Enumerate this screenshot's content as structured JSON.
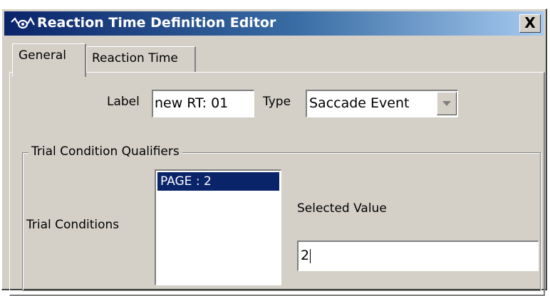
{
  "window": {
    "title": "Reaction Time Definition Editor",
    "close_label": "X",
    "icon": "eye-trajectory-icon"
  },
  "tabs": [
    {
      "label": "General",
      "active": true
    },
    {
      "label": "Reaction Time",
      "active": false
    }
  ],
  "general": {
    "label_caption": "Label",
    "label_value": "new RT: 01",
    "type_caption": "Type",
    "type_value": "Saccade Event",
    "qualifiers_group": "Trial Condition Qualifiers",
    "trial_conditions_caption": "Trial Conditions",
    "trial_conditions": [
      {
        "text": "PAGE : 2",
        "selected": true
      }
    ],
    "selected_value_caption": "Selected Value",
    "selected_value": "2"
  },
  "colors": {
    "title_bar": "#0a246a",
    "dialog_face": "#d4d0c8",
    "selection": "#0a246a"
  }
}
